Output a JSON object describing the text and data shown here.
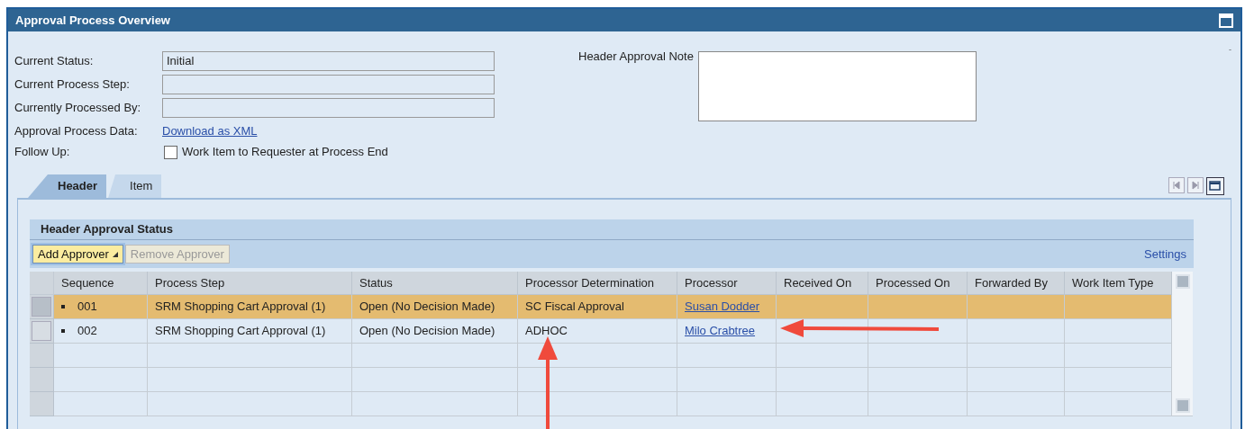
{
  "window": {
    "title": "Approval Process Overview"
  },
  "form": {
    "fields": [
      {
        "label": "Current Status:",
        "value": "Initial"
      },
      {
        "label": "Current Process Step:"
      },
      {
        "label": "Currently Processed By:"
      }
    ],
    "process_data": {
      "label": "Approval Process Data:",
      "link": "Download as XML"
    },
    "follow_up": {
      "label": "Follow Up:",
      "checkbox_label": "Work Item to Requester at Process End",
      "checked": false
    },
    "note": {
      "label": "Header Approval Note"
    },
    "corner_mark": "-"
  },
  "tabs": [
    {
      "label": "Header",
      "selected": true
    },
    {
      "label": "Item",
      "selected": false
    }
  ],
  "section": {
    "title": "Header Approval Status",
    "toolbar": [
      {
        "label": "Add Approver",
        "disabled": false,
        "menu": true
      },
      {
        "label": "Remove Approver",
        "disabled": true,
        "menu": false
      }
    ],
    "settings": "Settings",
    "table": {
      "columns": [
        {
          "label": "Sequence",
          "kind": "sequence"
        },
        {
          "label": "Process Step",
          "kind": "text"
        },
        {
          "label": "Status",
          "kind": "text"
        },
        {
          "label": "Processor Determination",
          "kind": "text"
        },
        {
          "label": "Processor",
          "kind": "link"
        },
        {
          "label": "Received On",
          "kind": "text"
        },
        {
          "label": "Processed On",
          "kind": "text"
        },
        {
          "label": "Forwarded By",
          "kind": "text"
        },
        {
          "label": "Work Item Type",
          "kind": "text"
        }
      ],
      "rows": [
        {
          "selected": true,
          "cells": [
            "001",
            "SRM Shopping Cart Approval (1)",
            "Open (No Decision Made)",
            "SC Fiscal Approval",
            "Susan Dodder"
          ]
        },
        {
          "selected": false,
          "cells": [
            "002",
            "SRM Shopping Cart Approval (1)",
            "Open (No Decision Made)",
            "ADHOC",
            "Milo Crabtree"
          ]
        }
      ]
    }
  }
}
